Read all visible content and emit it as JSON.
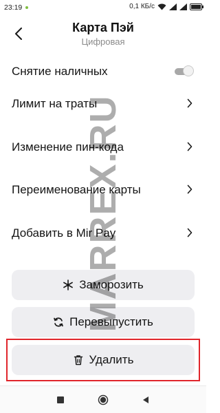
{
  "status_bar": {
    "time": "23:19",
    "network_speed": "0,1 КБ/с",
    "icons": [
      "wifi-icon",
      "signal-icon",
      "signal-icon",
      "battery-icon"
    ]
  },
  "header": {
    "title": "Карта Пэй",
    "subtitle": "Цифровая",
    "back_icon": "chevron-left-icon"
  },
  "settings": [
    {
      "label": "Снятие наличных",
      "control": "toggle",
      "toggle_on": false
    },
    {
      "label": "Лимит на траты",
      "control": "chevron"
    },
    {
      "label": "Изменение пин-кода",
      "control": "chevron"
    },
    {
      "label": "Переименование карты",
      "control": "chevron"
    },
    {
      "label": "Добавить в Mir Pay",
      "control": "chevron"
    }
  ],
  "actions": {
    "freeze": {
      "label": "Заморозить",
      "icon": "snowflake-icon"
    },
    "reissue": {
      "label": "Перевыпустить",
      "icon": "refresh-icon"
    },
    "delete": {
      "label": "Удалить",
      "icon": "trash-icon"
    }
  },
  "watermark": "MARREX.RU",
  "colors": {
    "button_bg": "#eeeef1",
    "highlight": "#e0252b",
    "subtitle": "#8a8a8a"
  },
  "nav_bar": {
    "icons": [
      "square-icon",
      "circle-home-icon",
      "triangle-back-icon"
    ]
  }
}
